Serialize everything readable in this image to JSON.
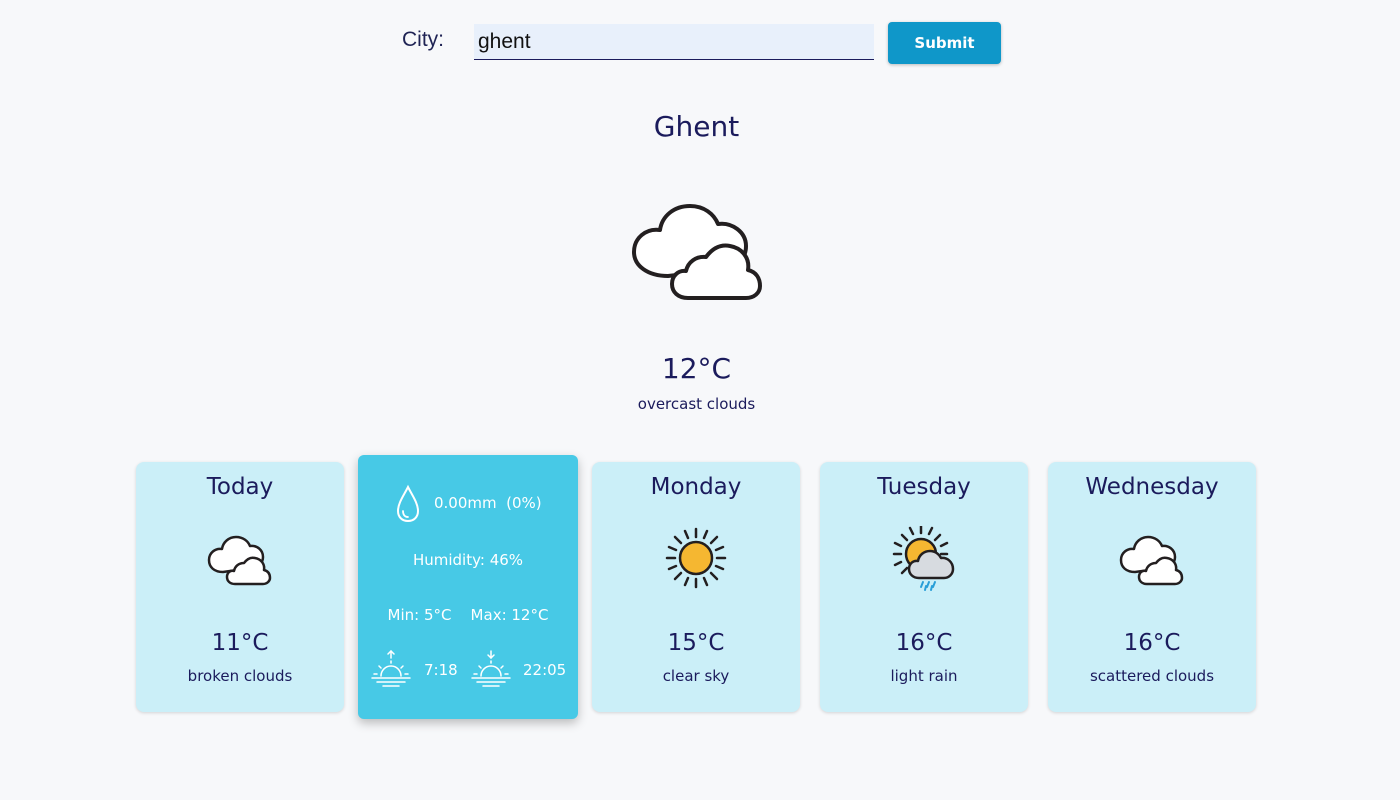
{
  "search": {
    "label": "City:",
    "value": "ghent",
    "submit_label": "Submit"
  },
  "current": {
    "city": "Ghent",
    "icon": "overcast-clouds-icon",
    "temperature": "12°C",
    "description": "overcast clouds"
  },
  "today": {
    "day": "Today",
    "icon": "broken-clouds-icon",
    "temperature": "11°C",
    "description": "broken clouds"
  },
  "details": {
    "precipitation": "0.00mm  (0%)",
    "humidity": "Humidity: 46%",
    "minmax": "Min: 5°C    Max: 12°C",
    "sunrise": "7:18",
    "sunset": "22:05"
  },
  "forecast": [
    {
      "day": "Monday",
      "icon": "clear-sky-icon",
      "temperature": "15°C",
      "description": "clear sky"
    },
    {
      "day": "Tuesday",
      "icon": "light-rain-icon",
      "temperature": "16°C",
      "description": "light rain"
    },
    {
      "day": "Wednesday",
      "icon": "scattered-clouds-icon",
      "temperature": "16°C",
      "description": "scattered clouds"
    }
  ],
  "colors": {
    "background": "#f7f8fa",
    "text": "#1b1b5c",
    "card": "#cbeff8",
    "detail_card": "#47c9e6",
    "button": "#0f97c9",
    "input_bg": "#e8f0fb",
    "sun": "#f5b731"
  }
}
